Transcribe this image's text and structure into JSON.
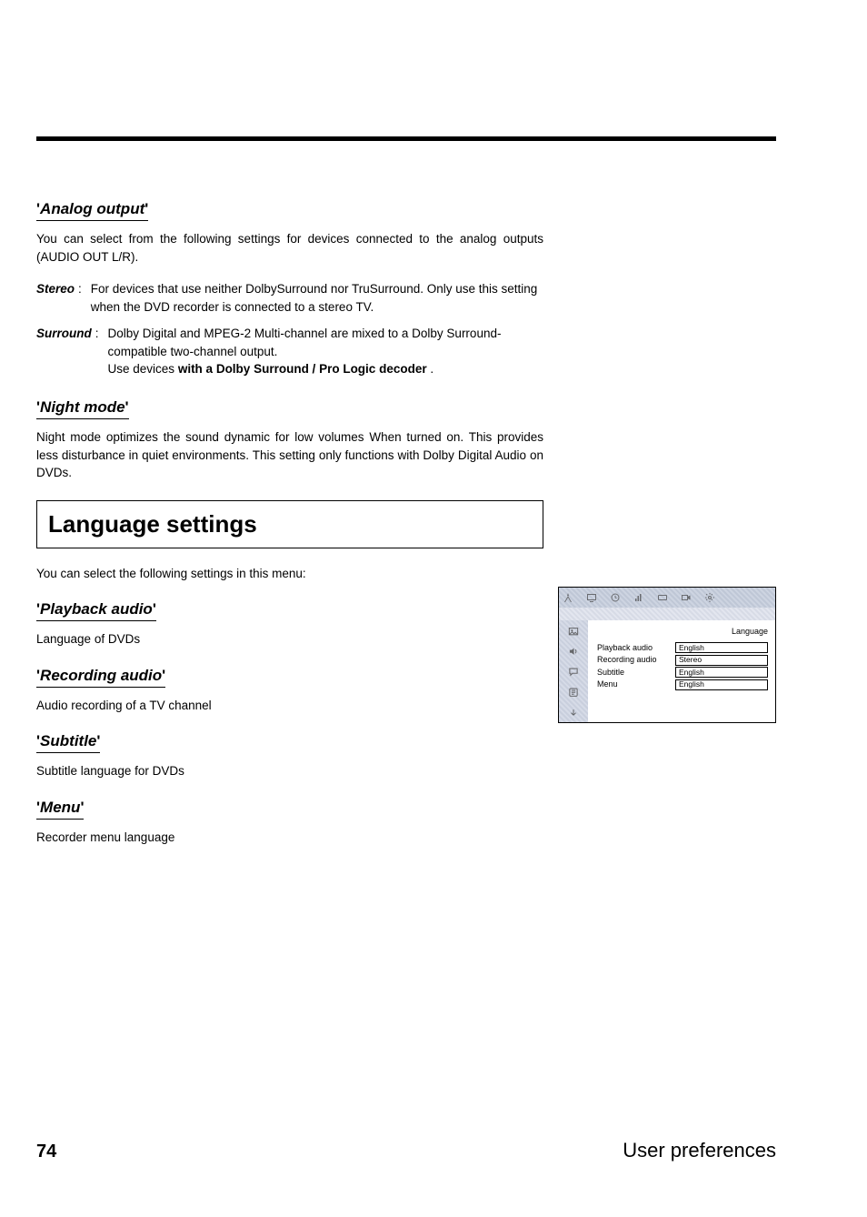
{
  "sections": {
    "analog": {
      "heading": "Analog output",
      "para": "You can select from the following settings for devices connected to the analog outputs (AUDIO OUT L/R).",
      "stereo": {
        "term": "Stereo",
        "desc": "For devices that use neither DolbySurround nor TruSurround. Only use this setting when the DVD recorder is connected to a stereo TV."
      },
      "surround": {
        "term": "Surround",
        "desc_line1": "Dolby Digital and MPEG-2 Multi-channel are mixed to a Dolby Surround-compatible two-channel output.",
        "desc_line2_pre": "Use devices ",
        "desc_line2_strong": "with a Dolby Surround / Pro Logic decoder",
        "desc_line2_post": " ."
      }
    },
    "night": {
      "heading": "Night mode",
      "para": "Night mode optimizes the sound dynamic for low volumes When turned on. This provides less disturbance in quiet environments. This setting only functions with Dolby Digital Audio on DVDs."
    },
    "lang": {
      "box_title": "Language settings",
      "intro": "You can select the following settings in this menu:",
      "playback": {
        "heading": "Playback audio",
        "desc": "Language of DVDs"
      },
      "recording": {
        "heading": "Recording audio",
        "desc": "Audio recording of a TV channel"
      },
      "subtitle": {
        "heading": "Subtitle",
        "desc": "Subtitle language for DVDs"
      },
      "menu": {
        "heading": "Menu",
        "desc": "Recorder menu language"
      }
    }
  },
  "osd": {
    "title": "Language",
    "rows": [
      {
        "label": "Playback audio",
        "value": "English"
      },
      {
        "label": "Recording audio",
        "value": "Stereo"
      },
      {
        "label": "Subtitle",
        "value": "English"
      },
      {
        "label": "Menu",
        "value": "English"
      }
    ],
    "top_icons": [
      "antenna-icon",
      "tv-icon",
      "clock-icon",
      "signal-icon",
      "card-icon",
      "video-icon",
      "gear-icon"
    ],
    "side_icons": [
      "picture-icon",
      "speaker-icon",
      "speech-icon",
      "features-icon"
    ]
  },
  "footer": {
    "page": "74",
    "title": "User preferences"
  }
}
